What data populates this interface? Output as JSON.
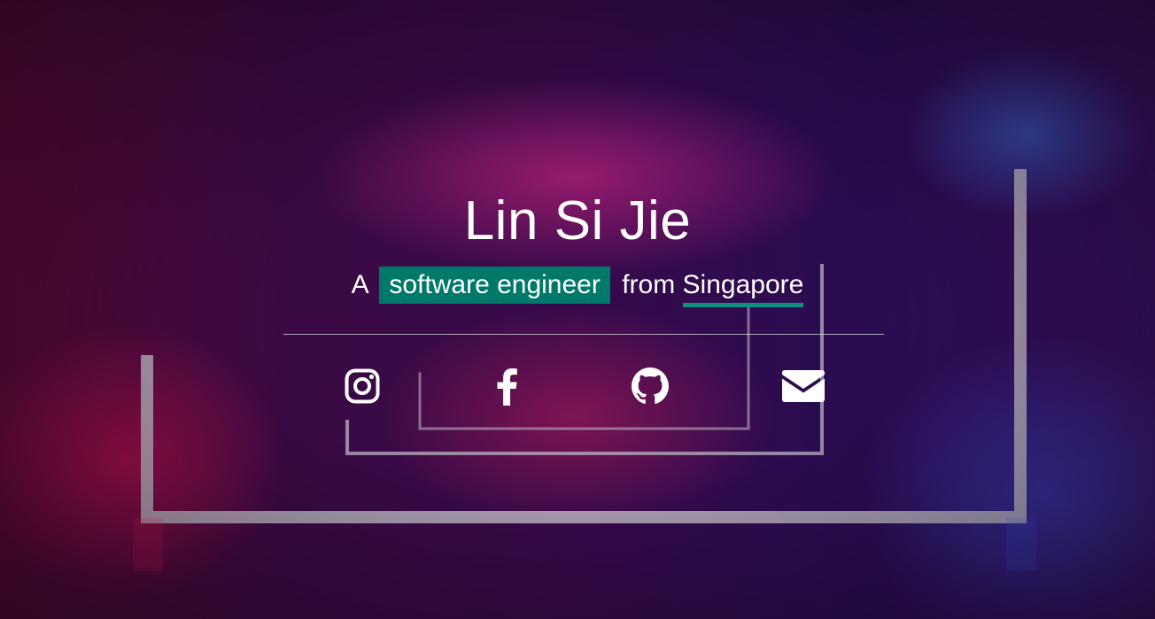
{
  "hero": {
    "name": "Lin Si Jie",
    "tagline_prefix": "A",
    "tagline_role": "software engineer",
    "tagline_middle": "from",
    "tagline_location": "Singapore"
  },
  "social_links": [
    {
      "icon": "instagram-icon"
    },
    {
      "icon": "facebook-icon"
    },
    {
      "icon": "github-icon"
    },
    {
      "icon": "envelope-icon"
    }
  ],
  "colors": {
    "highlight": "#00796b",
    "underline": "#0f8f80",
    "text": "#ffffff"
  }
}
